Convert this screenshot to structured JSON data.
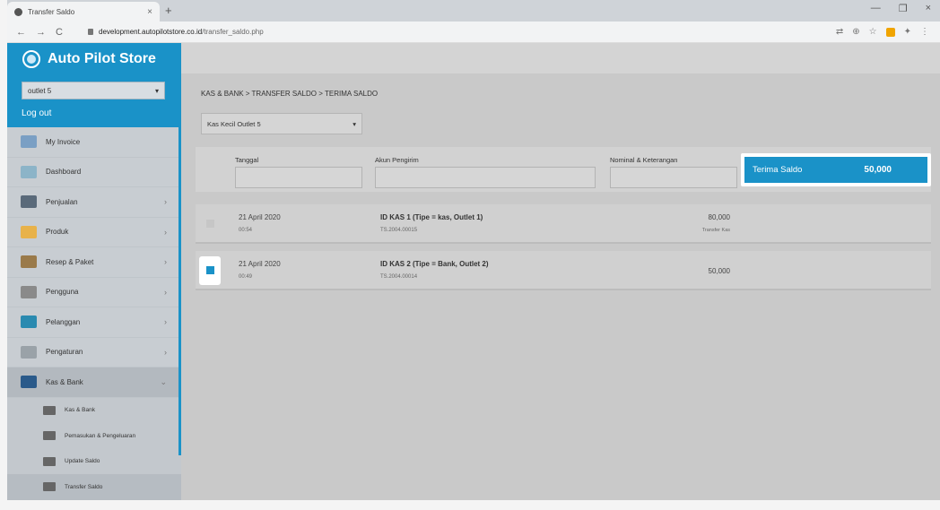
{
  "browser": {
    "tab_title": "Transfer Saldo",
    "tab_close": "×",
    "new_tab": "+",
    "url_host": "development.autopilotstore.co.id",
    "url_path": "/transfer_saldo.php",
    "nav_back": "←",
    "nav_forward": "→",
    "nav_reload": "C",
    "win_min": "—",
    "win_max": "❐",
    "win_close": "×"
  },
  "sidebar": {
    "brand": "Auto Pilot Store",
    "outlet_value": "outlet 5",
    "logout": "Log out",
    "items": [
      {
        "label": "My Invoice",
        "icon": "invoice-icon",
        "color": "#7a9fc4",
        "chevron": ""
      },
      {
        "label": "Dashboard",
        "icon": "dashboard-icon",
        "color": "#8cb4c8",
        "chevron": ""
      },
      {
        "label": "Penjualan",
        "icon": "cart-icon",
        "color": "#5a6a7a",
        "chevron": "›"
      },
      {
        "label": "Produk",
        "icon": "box-icon",
        "color": "#e8b24a",
        "chevron": "›"
      },
      {
        "label": "Resep & Paket",
        "icon": "bowl-icon",
        "color": "#9a7a4a",
        "chevron": "›"
      },
      {
        "label": "Pengguna",
        "icon": "user-icon",
        "color": "#8a8a8a",
        "chevron": "›"
      },
      {
        "label": "Pelanggan",
        "icon": "customers-icon",
        "color": "#2a8ab0",
        "chevron": "›"
      },
      {
        "label": "Pengaturan",
        "icon": "settings-icon",
        "color": "#9aa2a8",
        "chevron": "›"
      },
      {
        "label": "Kas & Bank",
        "icon": "kas-bank-icon",
        "color": "#2a5a8a",
        "chevron": "⌄"
      }
    ],
    "subitems": [
      {
        "label": "Kas & Bank",
        "icon": "wallet-icon"
      },
      {
        "label": "Pemasukan & Pengeluaran",
        "icon": "cash-flow-icon"
      },
      {
        "label": "Update Saldo",
        "icon": "update-saldo-icon"
      },
      {
        "label": "Transfer Saldo",
        "icon": "transfer-icon"
      }
    ]
  },
  "main": {
    "breadcrumb": "KAS & BANK > TRANSFER SALDO > TERIMA SALDO",
    "kas_select": "Kas Kecil Outlet 5",
    "filters": {
      "tanggal": "Tanggal",
      "akun_pengirim": "Akun Pengirim",
      "nominal": "Nominal & Keterangan"
    },
    "terima_label": "Terima Saldo",
    "terima_amount": "50,000",
    "rows": [
      {
        "date": "21 April 2020",
        "time": "00:54",
        "account": "ID KAS 1 (Tipe = kas, Outlet 1)",
        "code": "TS.2004.00015",
        "nominal": "80,000",
        "keterangan": "Transfer Kas",
        "checked": false
      },
      {
        "date": "21 April 2020",
        "time": "00:49",
        "account": "ID KAS 2 (Tipe = Bank, Outlet 2)",
        "code": "TS.2004.00014",
        "nominal": "50,000",
        "keterangan": "",
        "checked": true
      }
    ]
  },
  "colors": {
    "brand": "#1a92c8",
    "checkbox_checked": "#1a92c8"
  }
}
